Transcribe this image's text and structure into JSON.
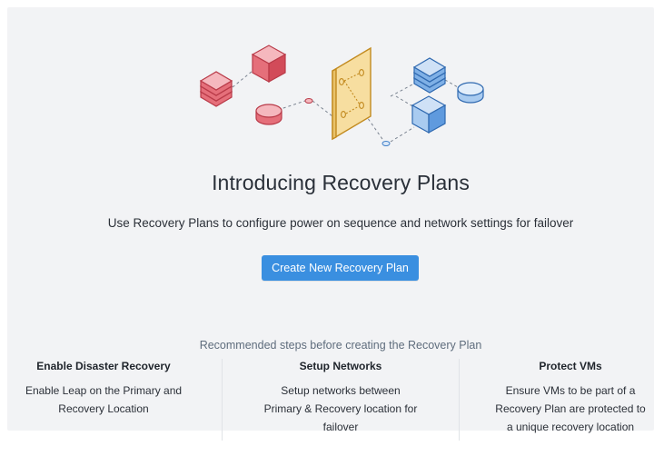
{
  "title": "Introducing Recovery Plans",
  "subtitle": "Use Recovery Plans to configure power on sequence and network settings for failover",
  "cta_label": "Create New Recovery Plan",
  "recommended_label": "Recommended steps before creating the Recovery Plan",
  "steps": [
    {
      "heading": "Enable Disaster Recovery",
      "line1": "Enable Leap on the Primary and",
      "line2": "Recovery Location",
      "line3": ""
    },
    {
      "heading": "Setup Networks",
      "line1": "Setup networks between",
      "line2": "Primary & Recovery location for",
      "line3": "failover"
    },
    {
      "heading": "Protect VMs",
      "line1": "Ensure VMs to be part of a",
      "line2": "Recovery Plan are protected to",
      "line3": "a unique recovery location"
    }
  ],
  "colors": {
    "accent": "#3a8fe0",
    "source_red": "#d9535f",
    "target_blue": "#3f7fc9",
    "plan_yellow": "#f7dea0"
  },
  "icons": [
    "red-database-stack-icon",
    "red-server-box-icon",
    "red-disk-icon",
    "recovery-plan-door-icon",
    "blue-database-stack-icon",
    "blue-server-box-icon",
    "blue-disk-icon"
  ]
}
